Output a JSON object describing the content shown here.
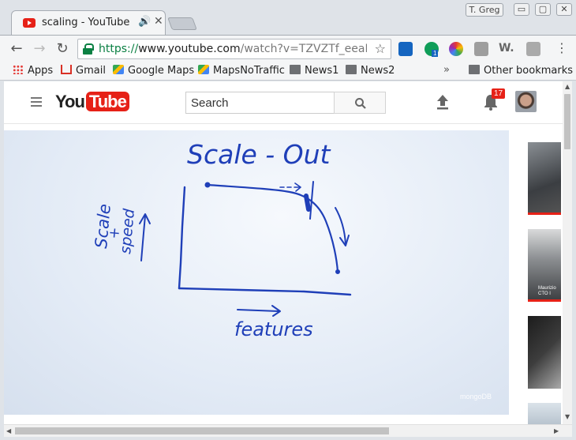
{
  "window": {
    "profile_name": "T. Greg",
    "buttons": {
      "minimize": "▭",
      "maximize": "▢",
      "close": "✕"
    }
  },
  "tab": {
    "title": "scaling - YouTube",
    "audio_icon": "🔊",
    "close": "✕"
  },
  "toolbar": {
    "url_scheme": "https://",
    "url_host": "www.youtube.com",
    "url_path": "/watch?v=TZVZTf_eeaM&fe",
    "extension_badge": "1",
    "icons": [
      "back-arrow-icon",
      "forward-arrow-icon",
      "reload-icon",
      "lock-icon",
      "star-icon",
      "menu-dots-icon"
    ]
  },
  "bookmarks": {
    "items": [
      "Apps",
      "Gmail",
      "Google Maps",
      "MapsNoTraffic",
      "News1",
      "News2"
    ],
    "overflow": "»",
    "other": "Other bookmarks"
  },
  "youtube": {
    "logo_you": "You",
    "logo_tube": "Tube",
    "search_placeholder": "Search",
    "notification_count": "17"
  },
  "video": {
    "whiteboard_title": "Scale - Out",
    "y_label_1": "Scale",
    "y_label_2": "+",
    "y_label_3": "speed",
    "x_label": "features",
    "watermark": "mongoDB"
  },
  "sidebar": {
    "thumb2_text": [
      "Maurizio",
      "CTO I"
    ]
  }
}
